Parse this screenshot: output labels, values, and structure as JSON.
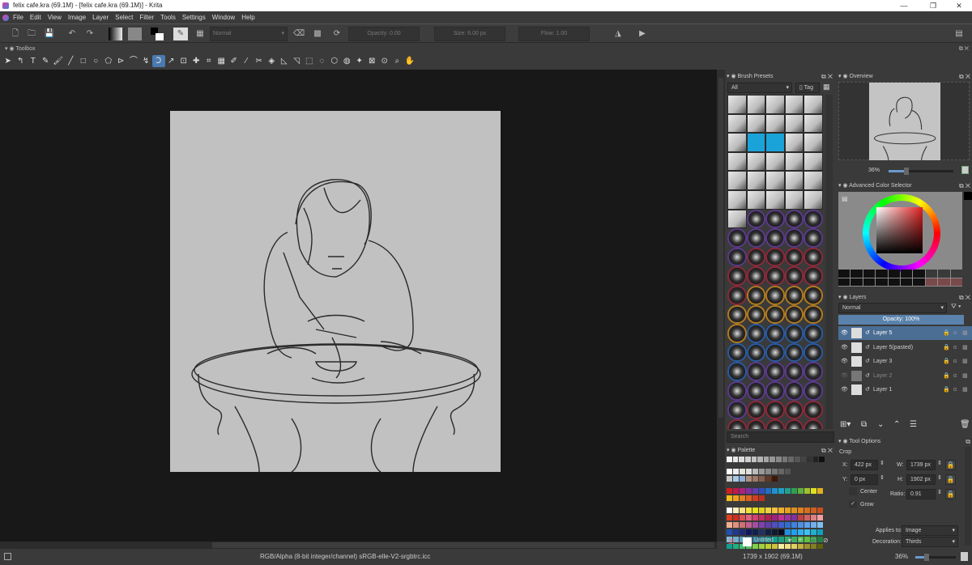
{
  "window": {
    "title": "felix cafe.kra (69.1M)  - [felix cafe.kra (69.1M)] - Krita",
    "minimize": "—",
    "maximize": "❐",
    "close": "✕"
  },
  "menu": [
    "File",
    "Edit",
    "View",
    "Image",
    "Layer",
    "Select",
    "Filter",
    "Tools",
    "Settings",
    "Window",
    "Help"
  ],
  "toolbar": {
    "blend_mode": "Normal",
    "opacity": "Opacity:  0.00",
    "size": "Size:  6.00 px",
    "flow": "Flow:  1.00"
  },
  "toolbox": {
    "title": "Toolbox",
    "tools": [
      "➤",
      "↰",
      "T",
      "✎",
      "🖌",
      "╱",
      "□",
      "○",
      "⬠",
      "⊳",
      "⌒",
      "↯",
      "Ↄ",
      "↗",
      "⊡",
      "✚",
      "⌗",
      "▦",
      "✐",
      "⁄",
      "✂",
      "◈",
      "◺",
      "◹",
      "⬚",
      "◌",
      "⬡",
      "◍",
      "✦",
      "⊠",
      "⊙",
      "⌕",
      "✋"
    ],
    "active_index": 12
  },
  "brush_presets": {
    "title": "Brush Presets",
    "filter": "All",
    "tag_label": "Tag",
    "search_placeholder": "Search"
  },
  "palette": {
    "title": "Palette",
    "name": "Untitled",
    "rows": [
      [
        "#f4f4f4",
        "#e8e8e8",
        "#dcdcdc",
        "#cfcfcf",
        "#c2c2c2",
        "#b4b4b4",
        "#a6a6a6",
        "#979797",
        "#888",
        "#787878",
        "#676767",
        "#565656",
        "#444",
        "#333",
        "#222",
        "#111"
      ],
      [],
      [
        "#fff",
        "#eee",
        "#e4e4d8",
        "#ddd",
        "#bbb",
        "#999",
        "#888",
        "#777",
        "#666",
        "#555"
      ],
      [
        "#c8c8c8",
        "#a8c8e8",
        "#90b0d8",
        "#b09080",
        "#a07868",
        "#806050",
        "#603828",
        "#401808"
      ],
      [],
      [
        "#d02020",
        "#c01850",
        "#b02080",
        "#8030a0",
        "#6040b0",
        "#3050c0",
        "#2070c0",
        "#2090d0",
        "#20a0c0",
        "#20a090",
        "#30a050",
        "#60b040",
        "#a0c030",
        "#e0e020",
        "#e0b020"
      ],
      [
        "#f0c020",
        "#f0a020",
        "#e08020",
        "#e06020",
        "#d04020",
        "#c03020"
      ],
      [],
      [
        "#fff",
        "#f8f0c0",
        "#f8e080",
        "#f0e040",
        "#e8e020",
        "#e0d020",
        "#f0d040",
        "#f8c040",
        "#f0b030",
        "#e8a020",
        "#e09020",
        "#e08020",
        "#d87020",
        "#d06020",
        "#c85020"
      ],
      [
        "#e04020",
        "#d03020",
        "#e05050",
        "#e06080",
        "#d04070",
        "#c03060",
        "#b02050",
        "#a02080",
        "#c03090",
        "#a030a0",
        "#8030a0",
        "#c04040",
        "#d06060",
        "#e08080",
        "#f0a0a0"
      ],
      [
        "#f0b090",
        "#e09080",
        "#d07070",
        "#c06090",
        "#a050a0",
        "#8040b0",
        "#6040b0",
        "#5050c0",
        "#4060d0",
        "#3070d0",
        "#4080e0",
        "#5090e0",
        "#60a0f0",
        "#70b0f0",
        "#80c0f0"
      ],
      [
        "#2050b0",
        "#203890",
        "#202878",
        "#101860",
        "#102050",
        "#203060",
        "#102040",
        "#101830",
        "#0a0a20",
        "#2090e0",
        "#20a0f0",
        "#30b0f0",
        "#40c0f0",
        "#20b0d0",
        "#10a0c0"
      ],
      [
        "#80c0e0",
        "#70b0d0",
        "#60a0c0",
        "#4090b0",
        "#3080a0",
        "#208090",
        "#109090",
        "#10a090",
        "#20a080",
        "#30b070",
        "#40b060",
        "#50c050",
        "#60c040",
        "#3c9a50",
        "#208040"
      ],
      [
        "#10a090",
        "#20b080",
        "#40c070",
        "#60c060",
        "#80d050",
        "#a0d040",
        "#c0d030",
        "#d0c040",
        "#f0f0a0",
        "#f0e080",
        "#e0d060",
        "#c0b040",
        "#a09030",
        "#808020",
        "#606010"
      ],
      [
        "#c08020",
        "#d09030",
        "#e0a040",
        "#c09050",
        "#a08060",
        "#806040",
        "#604020",
        "#a04030",
        "#c03050",
        "#902040",
        "#702030",
        "#502020",
        "#301010",
        "#200808",
        "#100404"
      ]
    ]
  },
  "overview": {
    "title": "Overview",
    "zoom": "36%"
  },
  "color_selector": {
    "title": "Advanced Color Selector"
  },
  "layers": {
    "title": "Layers",
    "blend_mode": "Normal",
    "opacity": "Opacity:  100%",
    "items": [
      {
        "name": "Layer 5",
        "visible": true,
        "selected": true
      },
      {
        "name": "Layer 5(pasted)",
        "visible": true,
        "selected": false
      },
      {
        "name": "Layer 3",
        "visible": true,
        "selected": false
      },
      {
        "name": "Layer 2",
        "visible": false,
        "selected": false
      },
      {
        "name": "Layer 1",
        "visible": true,
        "selected": false
      }
    ]
  },
  "tool_options": {
    "title": "Tool Options",
    "tool": "Crop",
    "x_label": "X:",
    "x": "422 px",
    "y_label": "Y:",
    "y": "0 px",
    "w_label": "W:",
    "w": "1739 px",
    "h_label": "H:",
    "h": "1902 px",
    "ratio_label": "Ratio:",
    "ratio": "0.91",
    "center": "Center",
    "grow": "Grow",
    "grow_checked": true,
    "applies_label": "Applies to:",
    "applies": "Image",
    "decoration_label": "Decoration:",
    "decoration": "Thirds"
  },
  "status": {
    "color_space": "RGB/Alpha (8-bit integer/channel)  sRGB-elle-V2-srgbtrc.icc",
    "dimensions": "1739 x 1902 (69.1M)",
    "zoom": "36%"
  }
}
